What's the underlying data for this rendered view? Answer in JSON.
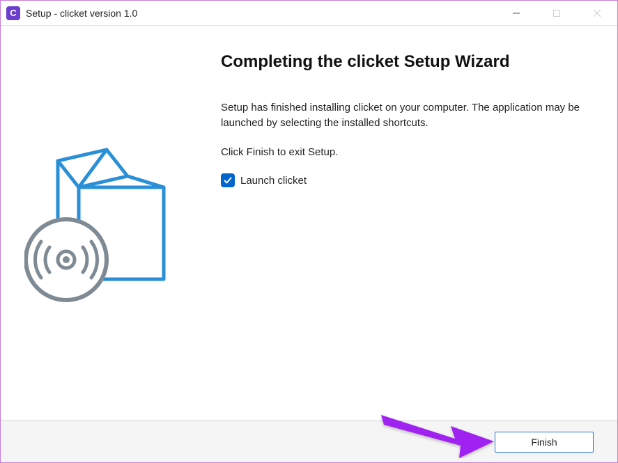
{
  "titlebar": {
    "title": "Setup - clicket version 1.0",
    "app_icon_letter": "C"
  },
  "main": {
    "heading": "Completing the clicket Setup Wizard",
    "body1": "Setup has finished installing clicket on your computer. The application may be launched by selecting the installed shortcuts.",
    "body2": "Click Finish to exit Setup.",
    "checkbox_label": "Launch clicket",
    "checkbox_checked": true
  },
  "footer": {
    "finish_label": "Finish"
  },
  "colors": {
    "accent_blue": "#0066cc",
    "button_border": "#2a73d8",
    "arrow": "#a020f0",
    "box_blue": "#2a8fd6"
  }
}
